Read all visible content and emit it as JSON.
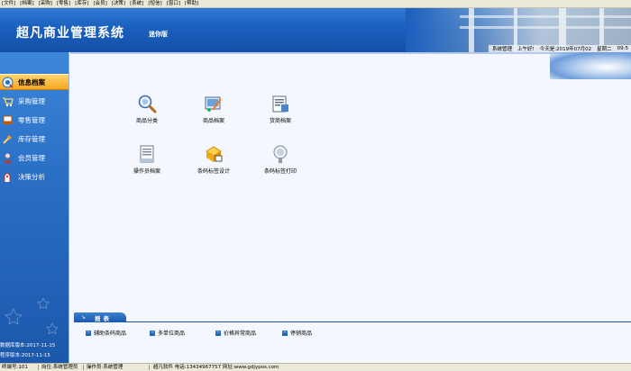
{
  "menu": [
    "[文件]",
    "[档案]",
    "[采购]",
    "[零售]",
    "[库存]",
    "[会员]",
    "[决策]",
    "[系统]",
    "[短信]",
    "[窗口]",
    "[帮助]"
  ],
  "header": {
    "title": "超凡商业管理系统",
    "edition": "迷你版",
    "status_items": [
      "系统管理",
      "上午好!",
      "今天是:2019年07月02",
      "星期二",
      "09:5"
    ]
  },
  "sidebar": {
    "items": [
      {
        "label": "信息档案",
        "icon": "info-file-icon",
        "active": true
      },
      {
        "label": "采购管理",
        "icon": "purchase-icon",
        "active": false
      },
      {
        "label": "零售管理",
        "icon": "retail-icon",
        "active": false
      },
      {
        "label": "库存管理",
        "icon": "inventory-icon",
        "active": false
      },
      {
        "label": "会员管理",
        "icon": "member-icon",
        "active": false
      },
      {
        "label": "决策分析",
        "icon": "analysis-icon",
        "active": false
      }
    ],
    "version_db": "数据库版本:2017-11-15",
    "version_app": "程序版本:2017-11-15"
  },
  "tiles": [
    {
      "label": "商品分类",
      "icon": "magnifier-icon"
    },
    {
      "label": "商品档案",
      "icon": "product-file-icon"
    },
    {
      "label": "货商档案",
      "icon": "supplier-file-icon"
    },
    {
      "label": "操作员档案",
      "icon": "operator-file-icon"
    },
    {
      "label": "条码标签设计",
      "icon": "barcode-design-icon"
    },
    {
      "label": "条码标签打印",
      "icon": "barcode-print-icon"
    }
  ],
  "report": {
    "tab_label": "报表",
    "items": [
      "辅助条码商品",
      "多单位商品",
      "价格异常商品",
      "停销商品"
    ]
  },
  "statusbar": {
    "terminal": "终端号:101",
    "post": "岗位:系统管理员",
    "operator": "操作员:系统管理",
    "company": "超凡软件 电话:13434967757 网址:www.gdjypos.com"
  },
  "colors": {
    "header_blue": "#1a5fbd",
    "sidebar_active": "#f6a623",
    "main_bg": "#f4f7fd"
  }
}
